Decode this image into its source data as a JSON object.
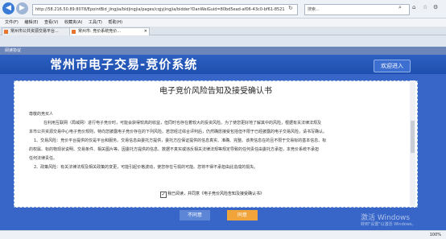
{
  "browser": {
    "url": "http://58.216.50.89:8078/EpointBid_jingjia/bidjingjia/pages/cqjyjingjia/bidder?DanWeiGuid=80bd5ead-af06-43c0-bf61-8521",
    "search_placeholder": "搜索...",
    "menu": [
      "文件(F)",
      "编辑(E)",
      "查看(V)",
      "收藏夹(A)",
      "工具(T)",
      "帮助(H)"
    ],
    "tabs": [
      {
        "label": "常州市公共资源交易平台..."
      },
      {
        "label": "常州市: 竞价系统竞价..."
      }
    ],
    "zoom": "100%"
  },
  "page": {
    "reading_label": "阅读协议",
    "title": "常州市电子交易-竞价系统",
    "welcome_button": "欢迎进入"
  },
  "document": {
    "title": "电子竞价风险告知及接受确认书",
    "paragraphs": [
      "尊敬的竞买人",
      "在利用互联网（局域网）进行电子竞价时，可能会获得较高的收益，但同时也存在着较大的投资风险。为了使您更好地了解其中的风险，根据有关法律法规及",
      "本市公共资源交易中心电子竞价规则，特向您披露电子竞价存在的下列风险。若您经过综合评判后，仍然确愿接受包括但不限于已经披露的电子交易风险，请书写确认。",
      "1、交易风险：竞价平台提供的仅是平台和服务。交易信息由委托方提供，委托方应保证提供的信息真实、准确、完整。该类信息在的且不限于交易标的基本信息、标",
      "的权属、标的物现状说明、交易条件、相关图片等。因委托方提供的信息、数据不真实或违反相关法律法规等规定导致的任何责任由委托方承担，本竞价系统不承担",
      "任何法律责任。",
      "2、政策风险：有关法律法规及相关政策的变更，可能引起价格波动，使您存在亏损的可能。您将不得不承担由此造成的损失。"
    ],
    "consent_text": "我已阅读，并同意《电子竞价风险告知及接受确认书》",
    "consent_checked": true
  },
  "buttons": {
    "disagree": "不同意",
    "agree": "同意"
  },
  "watermark": {
    "line1": "激活 Windows",
    "line2": "转到\"设置\"以激活 Windows。"
  },
  "colors": {
    "banner": "#2d60c2",
    "page_bg": "#3766c8",
    "agree_button": "#f0a43a",
    "disagree_button": "#5d86d6"
  }
}
